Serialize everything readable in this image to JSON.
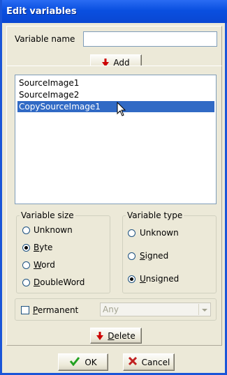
{
  "window": {
    "title": "Edit variables"
  },
  "name_row": {
    "label": "Variable name",
    "value": ""
  },
  "add_button": {
    "label": "Add"
  },
  "variables": [
    {
      "name": "SourceImage1",
      "selected": false
    },
    {
      "name": "SourceImage2",
      "selected": false
    },
    {
      "name": "CopySourceImage1",
      "selected": true
    }
  ],
  "size_group": {
    "title": "Variable size",
    "options": [
      {
        "label": "Unknown",
        "checked": false
      },
      {
        "label": "Byte",
        "checked": true
      },
      {
        "label": "Word",
        "checked": false
      },
      {
        "label": "DoubleWord",
        "checked": false
      }
    ]
  },
  "type_group": {
    "title": "Variable type",
    "options": [
      {
        "label": "Unknown",
        "checked": false
      },
      {
        "label": "Signed",
        "checked": false
      },
      {
        "label": "Unsigned",
        "checked": true
      }
    ]
  },
  "permanent": {
    "label": "Permanent",
    "checked": false,
    "combo_value": "Any"
  },
  "delete_button": {
    "label": "Delete"
  },
  "ok_button": {
    "label": "OK"
  },
  "cancel_button": {
    "label": "Cancel"
  },
  "colors": {
    "title_bar": "#0a4fe0",
    "selection": "#316ac5",
    "face": "#ece9d8",
    "arrow": "#cc0000",
    "ok_check": "#21a121",
    "cancel_x": "#c02020"
  }
}
